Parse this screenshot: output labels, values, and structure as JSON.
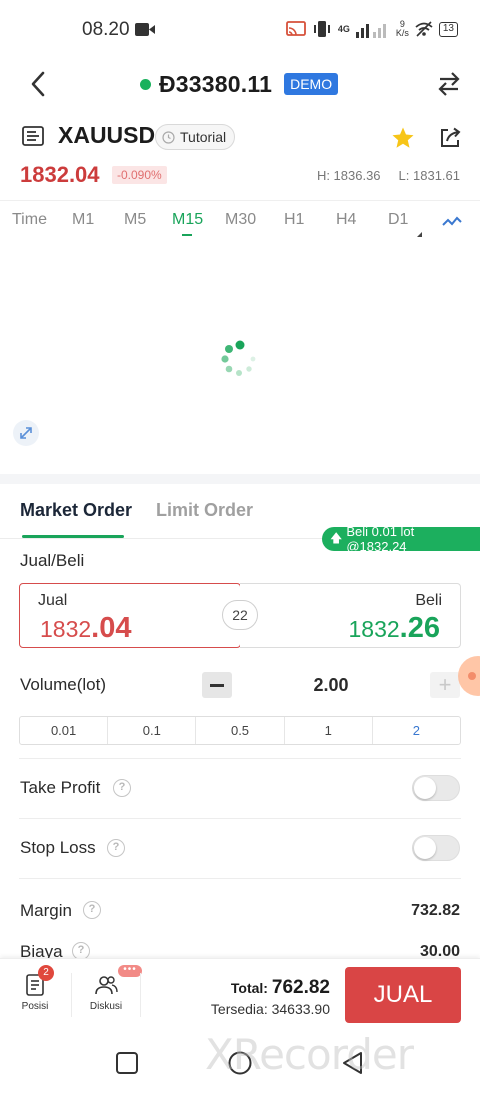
{
  "status_bar": {
    "time": "08.20",
    "network_speed": "9",
    "network_unit": "K/s",
    "signal_label": "4G",
    "battery": "13"
  },
  "header": {
    "balance": "Đ33380.11",
    "account_type": "DEMO"
  },
  "symbol": {
    "name": "XAUUSD",
    "tutorial_label": "Tutorial",
    "price": "1832.04",
    "change": "-0.090%",
    "high": "H: 1836.36",
    "low": "L: 1831.61"
  },
  "timeframes": [
    "Time",
    "M1",
    "M5",
    "M15",
    "M30",
    "H1",
    "H4",
    "D1"
  ],
  "active_timeframe": "M15",
  "order": {
    "tab_market": "Market Order",
    "tab_limit": "Limit Order",
    "notification": "Beli 0.01 lot @1832.24",
    "direction_label": "Jual/Beli",
    "sell_label": "Jual",
    "sell_price_main": "1832",
    "sell_price_big": ".04",
    "buy_label": "Beli",
    "buy_price_main": "1832",
    "buy_price_big": ".26",
    "spread": "22",
    "volume_label": "Volume(lot)",
    "volume_value": "2.00",
    "plus": "+",
    "lots": [
      "0.01",
      "0.1",
      "0.5",
      "1",
      "2"
    ],
    "take_profit_label": "Take Profit",
    "take_profit_enabled": false,
    "stop_loss_label": "Stop Loss",
    "stop_loss_enabled": false,
    "margin_label": "Margin",
    "margin_value": "732.82",
    "fee_label": "Biaya",
    "fee_value": "30.00",
    "help_icon": "?"
  },
  "bottom_bar": {
    "positions_label": "Posisi",
    "positions_badge": "2",
    "discussion_label": "Diskusi",
    "discussion_badge": "•••",
    "total_label": "Total:",
    "total_value": "762.82",
    "available": "Tersedia: 34633.90",
    "sell_button": "JUAL"
  },
  "watermark": "XRecorder",
  "colors": {
    "accent_green": "#19a45a",
    "sell_red": "#d94545",
    "demo_blue": "#2f78e0"
  }
}
